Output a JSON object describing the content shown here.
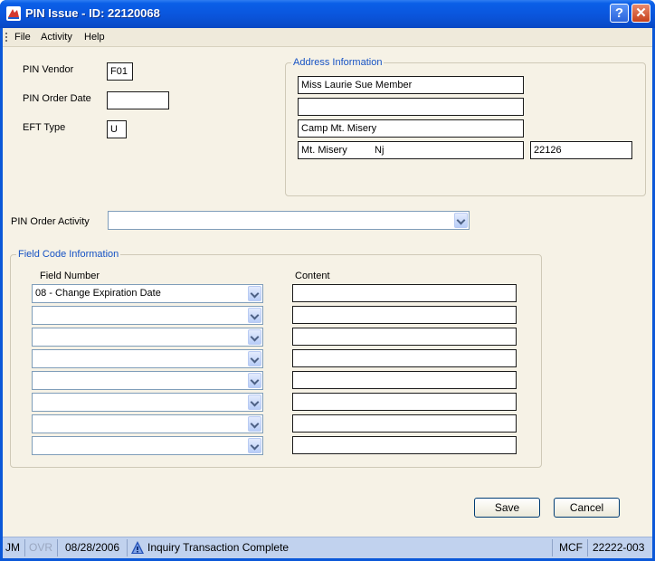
{
  "window": {
    "title": "PIN Issue - ID: 22120068"
  },
  "titlebar_buttons": {
    "help": "?",
    "close": "✕"
  },
  "menu": [
    "File",
    "Activity",
    "Help"
  ],
  "pin": {
    "vendor_label": "PIN Vendor",
    "vendor_value": "F01",
    "order_date_label": "PIN Order Date",
    "order_date_value": "",
    "eft_type_label": "EFT Type",
    "eft_type_value": "U"
  },
  "address": {
    "group_title": "Address Information",
    "line1": "Miss Laurie Sue Member",
    "line2": "",
    "line3": "Camp Mt. Misery",
    "city": "Mt. Misery",
    "state": "Nj",
    "zip": "22126"
  },
  "order_activity": {
    "label": "PIN Order Activity",
    "value": ""
  },
  "field_codes": {
    "group_title": "Field Code Information",
    "col_field_number": "Field Number",
    "col_content": "Content",
    "rows": [
      {
        "field_number": "08 - Change Expiration Date",
        "content": ""
      },
      {
        "field_number": "",
        "content": ""
      },
      {
        "field_number": "",
        "content": ""
      },
      {
        "field_number": "",
        "content": ""
      },
      {
        "field_number": "",
        "content": ""
      },
      {
        "field_number": "",
        "content": ""
      },
      {
        "field_number": "",
        "content": ""
      },
      {
        "field_number": "",
        "content": ""
      }
    ]
  },
  "buttons": {
    "save": "Save",
    "cancel": "Cancel"
  },
  "status": {
    "user": "JM",
    "ovr": "OVR",
    "date": "08/28/2006",
    "message": "Inquiry Transaction Complete",
    "system": "MCF",
    "code": "22222-003"
  },
  "colors": {
    "title_bar": "#0a55dc",
    "group_title": "#1652c4",
    "status_bar": "#c1d2ee"
  }
}
